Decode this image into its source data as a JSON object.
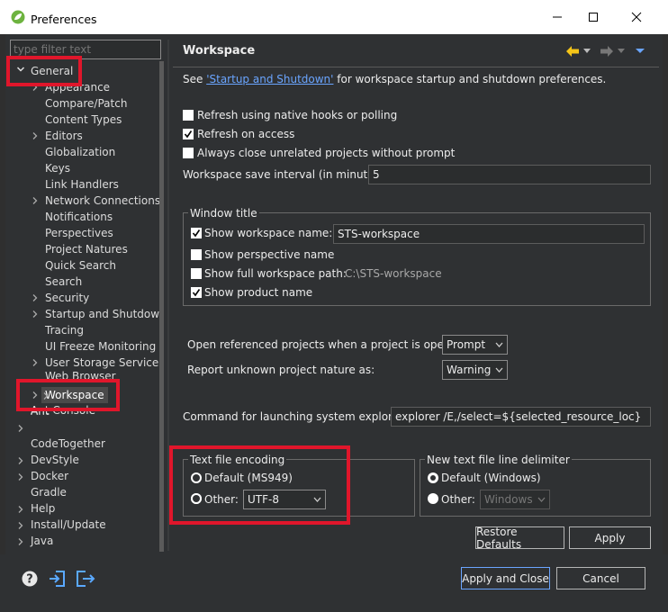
{
  "window": {
    "title": "Preferences",
    "icon": "leaf-icon",
    "minimize": "—",
    "maximize": "☐",
    "close": "✕"
  },
  "filter": {
    "placeholder": "type filter text"
  },
  "tree": {
    "general": "General",
    "general_children": [
      "Appearance",
      "Compare/Patch",
      "Content Types",
      "Editors",
      "Globalization",
      "Keys",
      "Link Handlers",
      "Network Connections",
      "Notifications",
      "Perspectives",
      "Project Natures",
      "Quick Search",
      "Search",
      "Security",
      "Startup and Shutdown",
      "Tracing",
      "UI Freeze Monitoring",
      "User Storage Service",
      "Web Browser",
      "Workspace"
    ],
    "top_level": [
      "Ant",
      "Ant Console",
      "CodeTogether",
      "DevStyle",
      "Docker",
      "Gradle",
      "Help",
      "Install/Update",
      "Java"
    ]
  },
  "page": {
    "title": "Workspace",
    "intro_prefix": "See ",
    "intro_link": "'Startup and Shutdown'",
    "intro_suffix": " for workspace startup and shutdown preferences.",
    "refresh_native": "Refresh using native hooks or polling",
    "refresh_access": "Refresh on access",
    "always_close": "Always close unrelated projects without prompt",
    "save_interval_label": "Workspace save interval (in minutes):",
    "save_interval_value": "5",
    "window_title_group": "Window title",
    "show_ws_name": "Show workspace name:",
    "ws_name_value": "STS-workspace",
    "show_persp": "Show perspective name",
    "show_full_path": "Show full workspace path:",
    "full_path_value": "C:\\STS-workspace",
    "show_product": "Show product name",
    "open_ref_label": "Open referenced projects when a project is opened:",
    "open_ref_value": "Prompt",
    "report_unknown_label": "Report unknown project nature as:",
    "report_unknown_value": "Warning",
    "cmd_label": "Command for launching system explorer:",
    "cmd_value": "explorer /E,/select=${selected_resource_loc}",
    "encoding_group": "Text file encoding",
    "enc_default": "Default (MS949)",
    "enc_other": "Other:",
    "enc_other_value": "UTF-8",
    "delim_group": "New text file line delimiter",
    "delim_default": "Default (Windows)",
    "delim_other": "Other:",
    "delim_other_value": "Windows",
    "restore_defaults": "Restore Defaults",
    "apply": "Apply"
  },
  "footer": {
    "apply_close": "Apply and Close",
    "cancel": "Cancel"
  },
  "state": {
    "refresh_native": false,
    "refresh_access": true,
    "always_close": false,
    "show_ws_name": true,
    "show_persp": false,
    "show_full_path": false,
    "show_product": true,
    "enc_selected": "other",
    "delim_selected": "default"
  },
  "colors": {
    "highlight_box": "#e0162b",
    "link": "#6aa5ff",
    "nav_back_arrow": "#f5c518",
    "selection_bg": "#4a4a4a"
  }
}
